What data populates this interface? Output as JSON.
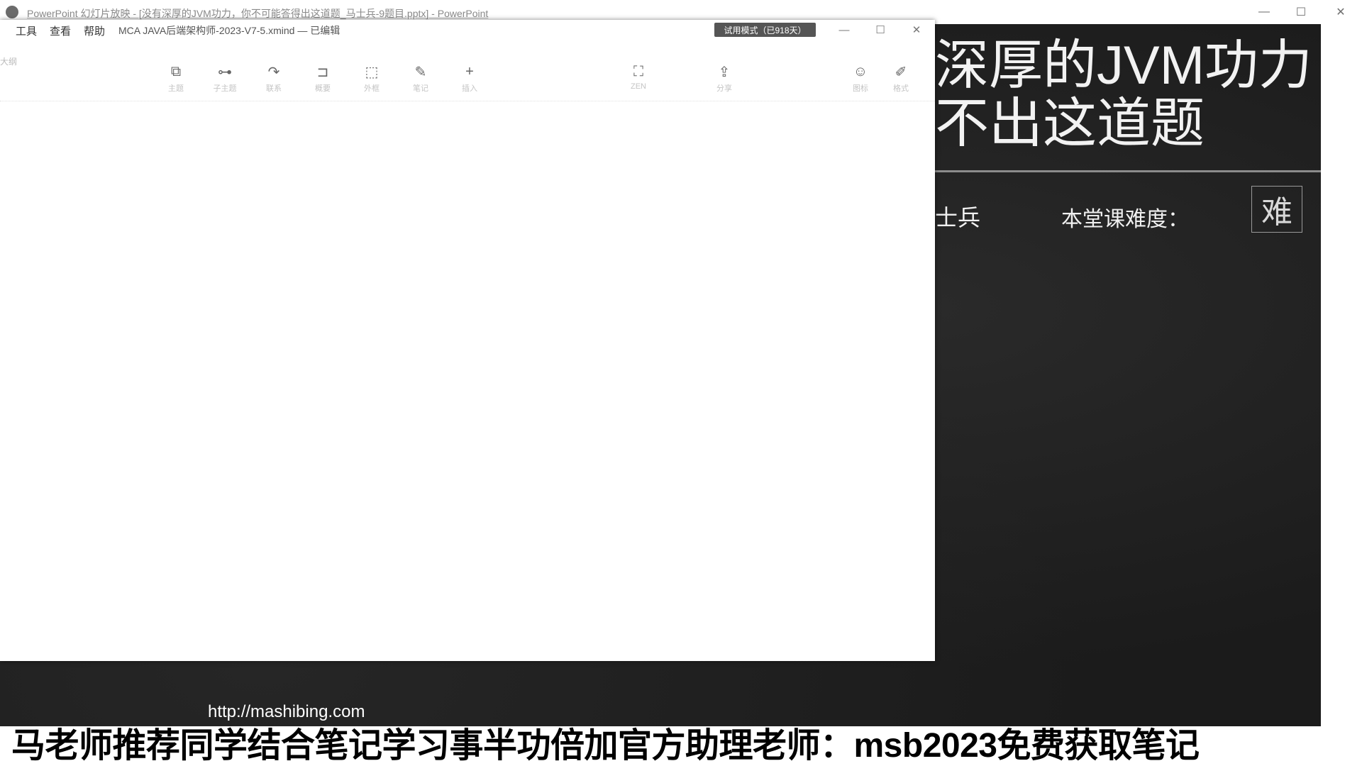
{
  "powerpoint": {
    "window_title": "PowerPoint 幻灯片放映 - [没有深厚的JVM功力，你不可能答得出这道题_马士兵-9题目.pptx] - PowerPoint",
    "controls": {
      "minimize": "—",
      "maximize": "☐",
      "close": "✕"
    }
  },
  "xmind": {
    "menu": [
      "工具",
      "查看",
      "帮助"
    ],
    "filename": "MCA JAVA后端架构师-2023-V7-5.xmind — 已编辑",
    "trial_badge": "试用模式（已918天）",
    "outline_label": "大纲",
    "controls": {
      "minimize": "—",
      "maximize": "☐",
      "close": "✕"
    },
    "toolbar": [
      {
        "label": "主题",
        "icon": "topic-icon",
        "glyph": "⧉"
      },
      {
        "label": "子主题",
        "icon": "subtopic-icon",
        "glyph": "⊶"
      },
      {
        "label": "联系",
        "icon": "relationship-icon",
        "glyph": "↷"
      },
      {
        "label": "概要",
        "icon": "summary-icon",
        "glyph": "⊐"
      },
      {
        "label": "外框",
        "icon": "boundary-icon",
        "glyph": "⬚"
      },
      {
        "label": "笔记",
        "icon": "note-icon",
        "glyph": "✎"
      },
      {
        "label": "插入",
        "icon": "insert-icon",
        "glyph": "+"
      },
      {
        "label": "ZEN",
        "icon": "zen-mode-icon",
        "glyph": "⛶"
      },
      {
        "label": "分享",
        "icon": "share-icon",
        "glyph": "⇪"
      },
      {
        "label": "图标",
        "icon": "sticker-icon",
        "glyph": "☺"
      },
      {
        "label": "格式",
        "icon": "format-icon",
        "glyph": "✐"
      }
    ]
  },
  "slide": {
    "title": "深厚的JVM功力\n不出这道题",
    "author_fragment": "士兵",
    "difficulty_label": "本堂课难度：",
    "difficulty_value": "难",
    "url": "http://mashibing.com"
  },
  "banner": {
    "text": "马老师推荐同学结合笔记学习事半功倍加官方助理老师：msb2023免费获取笔记"
  }
}
